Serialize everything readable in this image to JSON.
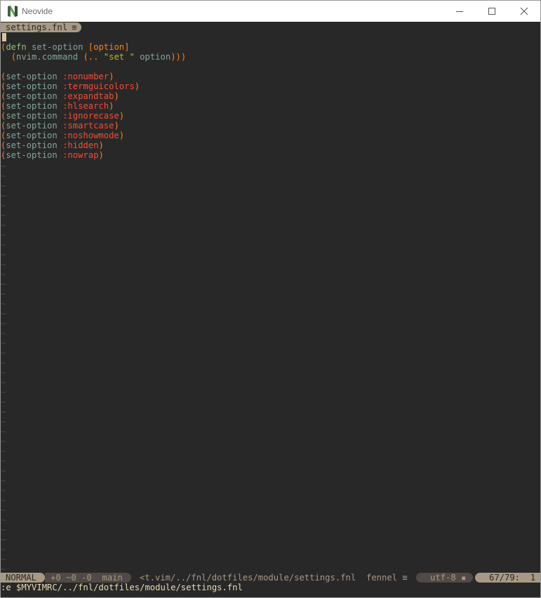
{
  "window": {
    "title": "Neovide",
    "icon": "neovide-n-icon",
    "controls": [
      "minimize-icon",
      "maximize-icon",
      "close-icon"
    ]
  },
  "tabline": {
    "active_tab": "settings.fnl",
    "active_tab_icon": "≡"
  },
  "buffer": {
    "defn": {
      "open": "(",
      "keyword": "defn",
      "name": "set-option",
      "args": "[option]"
    },
    "body": {
      "open": "(",
      "fn": "nvim.command",
      "inner_open": "(..",
      "string": "\"set \"",
      "arg": "option",
      "close": ")))"
    },
    "option_fn": "set-option",
    "options": [
      ":nonumber",
      ":termguicolors",
      ":expandtab",
      ":hlsearch",
      ":ignorecase",
      ":smartcase",
      ":noshowmode",
      ":hidden",
      ":nowrap"
    ],
    "empty_line_marker": "~",
    "empty_line_count": 42
  },
  "statusline": {
    "mode": "NORMAL",
    "diff": "+0 ~0 -0",
    "branch_icon": "",
    "branch": "main",
    "filepath": "<t.vim/../fnl/dotfiles/module/settings.fnl",
    "filetype": "fennel",
    "filetype_icon": "≡",
    "encoding": "utf-8",
    "os_icon": "▪",
    "position": "67/79:  1"
  },
  "cmdline": {
    "text": ":e $MYVIMRC/../fnl/dotfiles/module/settings.fnl"
  },
  "colors": {
    "background": "#282828",
    "paren": "#fe8019",
    "function": "#83a598",
    "keyword": "#8ec07c",
    "symbol": "#fb4934",
    "string": "#b8bb26",
    "status_accent": "#a89984",
    "status_dim": "#504945"
  }
}
